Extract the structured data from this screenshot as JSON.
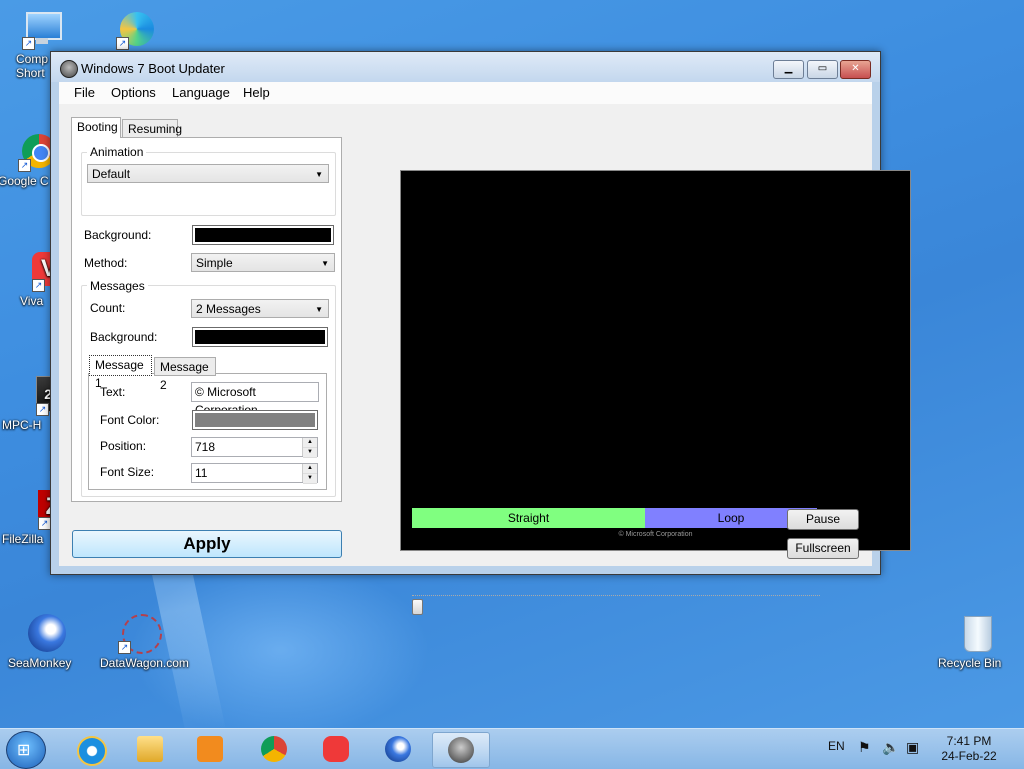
{
  "desktop": {
    "icons": [
      {
        "label": "Comp\nShort",
        "id": "computer"
      },
      {
        "label": "Google C",
        "id": "chrome"
      },
      {
        "label": "Viva",
        "id": "vivaldi"
      },
      {
        "label": "MPC-H",
        "id": "mpc"
      },
      {
        "label": "FileZilla",
        "id": "filezilla"
      },
      {
        "label": "SeaMonkey",
        "id": "seamonkey"
      },
      {
        "label": "DataWagon.com",
        "id": "datawagon"
      },
      {
        "label": "Recycle Bin",
        "id": "recycle"
      }
    ]
  },
  "window": {
    "title": "Windows 7 Boot Updater",
    "menu": [
      "File",
      "Options",
      "Language",
      "Help"
    ],
    "tabs": [
      "Booting",
      "Resuming"
    ],
    "animation": {
      "group_label": "Animation",
      "value": "Default"
    },
    "background_label": "Background:",
    "background_color": "#000000",
    "method": {
      "label": "Method:",
      "value": "Simple"
    },
    "messages": {
      "group_label": "Messages",
      "count_label": "Count:",
      "count_value": "2 Messages",
      "background_label": "Background:",
      "background_color": "#000000",
      "tabs": [
        "Message 1",
        "Message 2"
      ],
      "text_label": "Text:",
      "text_value": "© Microsoft Corporation",
      "font_color_label": "Font Color:",
      "font_color": "#808080",
      "position_label": "Position:",
      "position_value": "718",
      "font_size_label": "Font Size:",
      "font_size_value": "11"
    },
    "apply_label": "Apply",
    "preview_text": "© Microsoft Corporation",
    "playback": {
      "straight_label": "Straight",
      "loop_label": "Loop",
      "straight_color": "#80ff80",
      "loop_color": "#8080ff"
    },
    "pause_label": "Pause",
    "fullscreen_label": "Fullscreen"
  },
  "taskbar": {
    "language": "EN",
    "time": "7:41 PM",
    "date": "24-Feb-22"
  }
}
